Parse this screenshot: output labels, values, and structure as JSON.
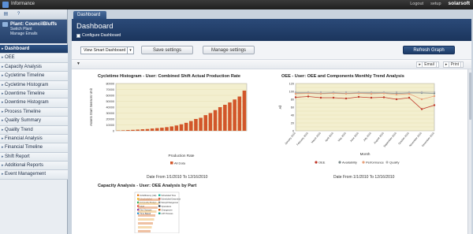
{
  "app": {
    "title": "Informance",
    "logout": "Logout",
    "setup": "setup",
    "brand": "solarsoft"
  },
  "plant": {
    "name": "Plant: CouncilBluffs",
    "switch": "Switch Plant",
    "manage": "Manage Emails"
  },
  "nav": {
    "items": [
      {
        "label": "Dashboard",
        "active": true
      },
      {
        "label": "OEE"
      },
      {
        "label": "Capacity Analysis"
      },
      {
        "label": "Cycletime Timeline"
      },
      {
        "label": "Cycletime Histogram"
      },
      {
        "label": "Downtime Timeline"
      },
      {
        "label": "Downtime Histogram"
      },
      {
        "label": "Process Timeline"
      },
      {
        "label": "Quality Summary"
      },
      {
        "label": "Quality Trend"
      },
      {
        "label": "Financial Analysis"
      },
      {
        "label": "Financial Timeline"
      },
      {
        "label": "Shift Report"
      },
      {
        "label": "Additional Reports"
      },
      {
        "label": "Event Management"
      }
    ]
  },
  "tab": {
    "label": "Dashboard"
  },
  "header": {
    "title": "Dashboard",
    "configure": "Configure Dashboard"
  },
  "toolbar": {
    "view_select": "View Smart Dashboard",
    "save": "Save settings",
    "manage": "Manage settings",
    "refresh": "Refresh Graph"
  },
  "subbar": {
    "email": "Email",
    "print": "Print"
  },
  "colors": {
    "bar": "#d2562a",
    "oee": "#c0392b",
    "availability": "#7f8c8d",
    "performance": "#e8a07a",
    "quality": "#b5b5b5",
    "band": "#f3efcf"
  },
  "charts": {
    "hist": {
      "title": "Cycletime Histogram - User: Combined Shift Actual Production Rate",
      "ylabel": "Assets Start Sensors Unit",
      "xlabel": "Production Rate",
      "legend": "All Data",
      "date": "Date From 1/1/2010 To 12/16/2010"
    },
    "oee": {
      "title": "OEE - User: OEE and Components Monthly Trend Analysis",
      "ylabel": "All",
      "xlabel": "Month",
      "legend": [
        "OEE",
        "Availability",
        "Performance",
        "Quality"
      ],
      "date": "Date From 1/1/2010 To 12/16/2010"
    },
    "capacity": {
      "title": "Capacity Analysis - User: OEE Analysis by Part",
      "legend": [
        "Ad Efficiency (AE)",
        "Unscheduled",
        "Ad Quality Budget",
        "Mold",
        "Die Changes",
        "Time Based",
        "Scheduled Time",
        "Scheduled Downtime",
        "Setup/Changeover",
        "Operations",
        "Changeover",
        "LRT Process"
      ]
    }
  },
  "chart_data": [
    {
      "type": "bar",
      "title": "Cycletime Histogram - User: Combined Shift Actual Production Rate",
      "xlabel": "Production Rate",
      "ylabel": "Assets Start Sensors Unit",
      "ylim": [
        0,
        80000
      ],
      "yticks": [
        "0",
        "10000",
        "20000",
        "30000",
        "40000",
        "50000",
        "60000",
        "70000",
        "80000"
      ],
      "series": [
        {
          "name": "All Data",
          "values": [
            500,
            800,
            1200,
            1600,
            2000,
            2600,
            3000,
            3800,
            4500,
            5200,
            6200,
            7400,
            9000,
            11000,
            13500,
            16500,
            20000,
            22000,
            26500,
            30000,
            35000,
            40000,
            44000,
            48000,
            53000,
            58000,
            68000
          ]
        }
      ]
    },
    {
      "type": "line",
      "title": "OEE - User: OEE and Components Monthly Trend Analysis",
      "xlabel": "Month",
      "ylabel": "All",
      "ylim": [
        0,
        120
      ],
      "yticks": [
        "0",
        "10",
        "20",
        "30",
        "40",
        "50",
        "60",
        "70",
        "80",
        "90",
        "100",
        "110",
        "120"
      ],
      "categories": [
        "January 2010",
        "February 2010",
        "March 2010",
        "April 2010",
        "May 2010",
        "June 2010",
        "July 2010",
        "August 2010",
        "September 2010",
        "October 2010",
        "November 2010",
        "December 2010"
      ],
      "series": [
        {
          "name": "OEE",
          "values": [
            85,
            87,
            84,
            84,
            82,
            86,
            84,
            85,
            80,
            84,
            55,
            65
          ]
        },
        {
          "name": "Availability",
          "values": [
            96,
            96,
            95,
            96,
            95,
            96,
            96,
            96,
            95,
            96,
            96,
            95
          ]
        },
        {
          "name": "Performance",
          "values": [
            94,
            95,
            94,
            95,
            94,
            95,
            94,
            95,
            92,
            94,
            80,
            88
          ]
        },
        {
          "name": "Quality",
          "values": [
            98,
            98,
            98,
            98,
            98,
            98,
            98,
            98,
            98,
            98,
            98,
            98
          ]
        }
      ]
    }
  ]
}
